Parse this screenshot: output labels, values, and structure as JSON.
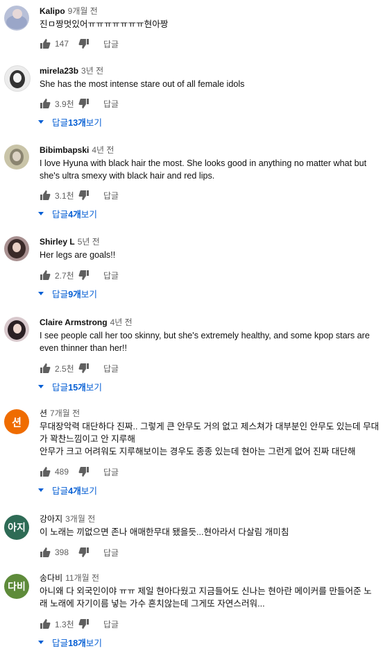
{
  "reply_label": "답글",
  "comments": [
    {
      "author": "Kalipo",
      "time": "9개월 전",
      "text": "진ㅁ짱멋있어ㅠㅠㅠㅠㅠㅠㅠ현아짱",
      "likes": "147",
      "replies_prefix": "",
      "replies_count": "",
      "replies_suffix": "",
      "avatar": {
        "type": "photo",
        "letter": "",
        "color": "#b8c0d8"
      }
    },
    {
      "author": "mirela23b",
      "time": "3년 전",
      "text": "She has the most intense stare out of all female idols",
      "likes": "3.9천",
      "replies_prefix": "답글 ",
      "replies_count": "13개",
      "replies_suffix": " 보기",
      "avatar": {
        "type": "photo",
        "letter": "",
        "color": "#e8e8e8"
      }
    },
    {
      "author": "Bibimbapski",
      "time": "4년 전",
      "text": "I love Hyuna with black hair the most. She looks good in anything no matter what but she's ultra smexy with black hair and red lips.",
      "likes": "3.1천",
      "replies_prefix": "답글 ",
      "replies_count": "4개",
      "replies_suffix": " 보기",
      "avatar": {
        "type": "photo",
        "letter": "",
        "color": "#c9c4a8"
      }
    },
    {
      "author": "Shirley L",
      "time": "5년 전",
      "text": "Her legs are goals!!",
      "likes": "2.7천",
      "replies_prefix": "답글 ",
      "replies_count": "9개",
      "replies_suffix": " 보기",
      "avatar": {
        "type": "photo",
        "letter": "",
        "color": "#b9a8a8"
      }
    },
    {
      "author": "Claire Armstrong",
      "time": "4년 전",
      "text": "I see people call her too skinny, but she's extremely healthy, and some kpop stars are even thinner than her!!",
      "likes": "2.5천",
      "replies_prefix": "답글 ",
      "replies_count": "15개",
      "replies_suffix": " 보기",
      "avatar": {
        "type": "photo",
        "letter": "",
        "color": "#c8b8c0"
      }
    },
    {
      "author": "션",
      "time": "7개월 전",
      "text": "무대장악력 대단하다 진짜.. 그렇게 큰 안무도 거의 없고 제스쳐가 대부분인 안무도 있는데 무대가 꽉찬느낌이고 안 지루해\n안무가 크고 어려워도 지루해보이는 경우도 종종 있는데 현아는 그런게 없어 진짜 대단해",
      "likes": "489",
      "replies_prefix": "답글 ",
      "replies_count": "4개",
      "replies_suffix": " 보기",
      "avatar": {
        "type": "letter",
        "letter": "션",
        "color": "#ef6c00"
      }
    },
    {
      "author": "강아지",
      "time": "3개월 전",
      "text": "이 노래는 끼없으면 존나 애매한무대 됐을듯...현아라서 다살림 개미침",
      "likes": "398",
      "replies_prefix": "",
      "replies_count": "",
      "replies_suffix": "",
      "avatar": {
        "type": "letter",
        "letter": "아지",
        "color": "#2e6b55"
      }
    },
    {
      "author": "송다비",
      "time": "11개월 전",
      "text": "아니왜 다 외국인이야 ㅠㅠ 제일 현아다웠고 지금들어도 신나는 현아란 메이커를 만들어준 노래 노래에 자기이름 넣는 가수 흔치않는데 그게또 자연스러워...",
      "likes": "1.3천",
      "replies_prefix": "답글 ",
      "replies_count": "18개",
      "replies_suffix": " 보기",
      "avatar": {
        "type": "letter",
        "letter": "다비",
        "color": "#5e8b3a"
      }
    }
  ]
}
